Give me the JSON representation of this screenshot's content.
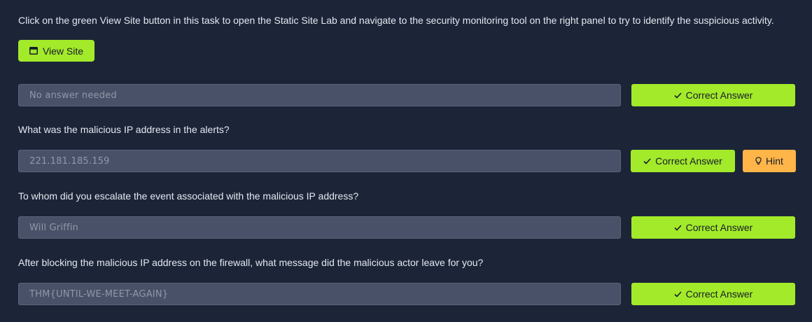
{
  "task": {
    "intro_text": "Click on the green View Site button in this task to open the Static Site Lab and navigate to the security monitoring tool on the right panel to try to identify the suspicious activity.",
    "view_site_label": "View Site"
  },
  "questions": [
    {
      "question": "",
      "answer": "",
      "placeholder": "No answer needed",
      "correct_label": "Correct Answer",
      "hint_label": ""
    },
    {
      "question": "What was the malicious IP address in the alerts?",
      "answer": "221.181.185.159",
      "placeholder": "",
      "correct_label": "Correct Answer",
      "hint_label": "Hint"
    },
    {
      "question": "To whom did you escalate the event associated with the malicious IP address?",
      "answer": "Will Griffin",
      "placeholder": "",
      "correct_label": "Correct Answer",
      "hint_label": ""
    },
    {
      "question": "After blocking the malicious IP address on the firewall, what message did the malicious actor leave for you?",
      "answer": "THM{UNTIL-WE-MEET-AGAIN}",
      "placeholder": "",
      "correct_label": "Correct Answer",
      "hint_label": ""
    }
  ],
  "icons": {
    "view_site": "window-icon",
    "correct": "check-icon",
    "hint": "lightbulb-icon"
  },
  "colors": {
    "background": "#1c2538",
    "accent_green": "#a3ea2a",
    "hint_orange": "#ffb547",
    "input_bg": "#485167"
  }
}
